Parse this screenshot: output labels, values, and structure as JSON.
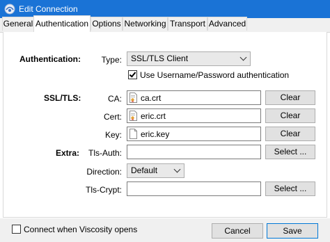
{
  "window": {
    "title": "Edit Connection"
  },
  "tabs": [
    "General",
    "Authentication",
    "Options",
    "Networking",
    "Transport",
    "Advanced"
  ],
  "authentication": {
    "section_label": "Authentication:",
    "type_label": "Type:",
    "type_value": "SSL/TLS Client",
    "use_userpass_label": "Use Username/Password authentication",
    "use_userpass_checked": true
  },
  "ssl_tls": {
    "section_label": "SSL/TLS:",
    "ca_label": "CA:",
    "ca_value": "ca.crt",
    "cert_label": "Cert:",
    "cert_value": "eric.crt",
    "key_label": "Key:",
    "key_value": "eric.key",
    "clear_label": "Clear"
  },
  "extra": {
    "section_label": "Extra:",
    "tls_auth_label": "Tls-Auth:",
    "tls_auth_value": "",
    "direction_label": "Direction:",
    "direction_value": "Default",
    "tls_crypt_label": "Tls-Crypt:",
    "tls_crypt_value": "",
    "select_label": "Select ..."
  },
  "footer": {
    "connect_label": "Connect when Viscosity opens",
    "connect_checked": false,
    "cancel_label": "Cancel",
    "save_label": "Save"
  },
  "colors": {
    "titlebar": "#1a73d6",
    "window_bg": "#f0f0f0",
    "panel_bg": "#ffffff"
  },
  "icons": {
    "app": "viscosity-app-icon",
    "certificate": "certificate-file-icon",
    "key": "key-file-icon"
  }
}
